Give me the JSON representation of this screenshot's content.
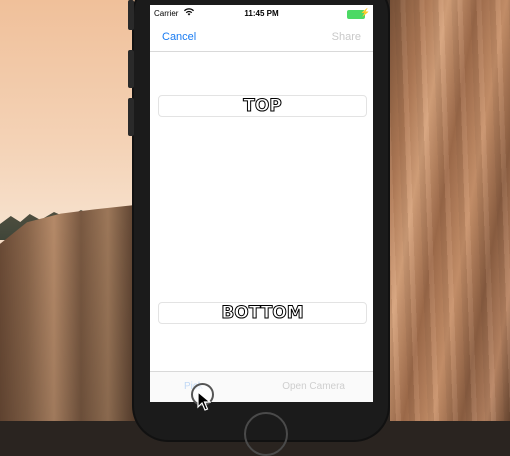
{
  "status_bar": {
    "carrier": "Carrier",
    "time": "11:45 PM"
  },
  "nav": {
    "cancel_label": "Cancel",
    "share_label": "Share"
  },
  "meme": {
    "top_text": "TOP",
    "bottom_text": "BOTTOM"
  },
  "toolbar": {
    "album_label": "Pick",
    "camera_label": "Open Camera"
  },
  "colors": {
    "accent": "#1a7cf2",
    "disabled": "#c9c9c9",
    "battery": "#4cd964"
  },
  "icons": [
    "wifi-icon",
    "battery-icon",
    "charging-bolt-icon",
    "touch-indicator",
    "mouse-cursor-icon"
  ]
}
